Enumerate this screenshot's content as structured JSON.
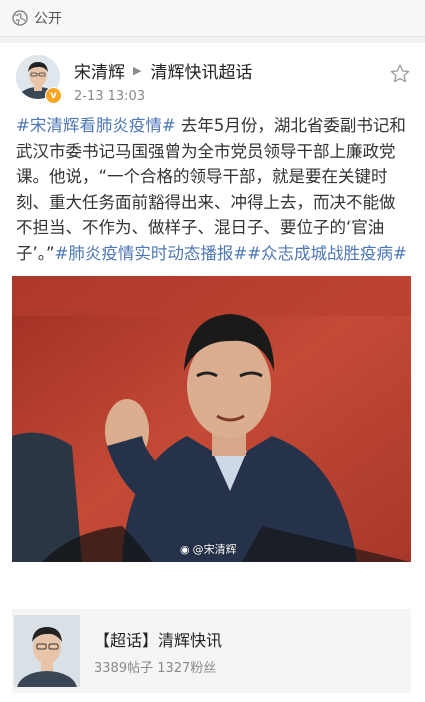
{
  "topbar": {
    "icon": "globe-icon",
    "label": "公开"
  },
  "post": {
    "author": "宋清辉",
    "channel": "清辉快讯超话",
    "time": "2-13 13:03",
    "text_segments": [
      {
        "tag": true,
        "text": "#宋清辉看肺炎疫情#"
      },
      {
        "tag": false,
        "text": " 去年5月份，湖北省委副书记和武汉市委书记马国强曾为全市党员领导干部上廉政党课。他说，“一个合格的领导干部，就是要在关键时刻、重大任务面前豁得出来、冲得上去，而决不能做不担当、不作为、做样子、混日子、要位子的‘官油子’。”"
      },
      {
        "tag": true,
        "text": "#肺炎疫情实时动态播报##众志成城战胜疫病#"
      }
    ],
    "watermark": "@宋清辉",
    "colors": {
      "tag": "#4d77b7",
      "badge": "#f5a623"
    }
  },
  "super_topic": {
    "title": "【超话】清辉快讯",
    "stats": "3389帖子 1327粉丝"
  }
}
